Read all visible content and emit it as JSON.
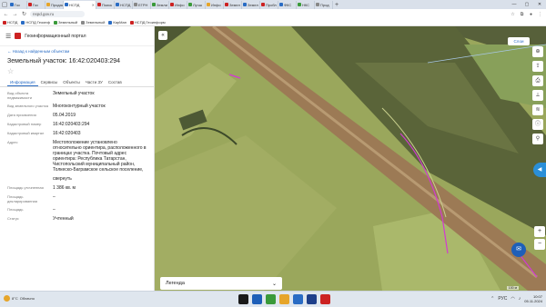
{
  "browser": {
    "tabs": [
      {
        "label": "Гос",
        "color": "#2a6cc4"
      },
      {
        "label": "Гос",
        "color": "#c22"
      },
      {
        "label": "Продаж",
        "color": "#e6a52a"
      },
      {
        "label": "НСПД",
        "color": "#2a6cc4",
        "active": true
      },
      {
        "label": "Поиск",
        "color": "#c22"
      },
      {
        "label": "НСПД",
        "color": "#2a6cc4"
      },
      {
        "label": "ЕГРН",
        "color": "#888"
      },
      {
        "label": "Земли",
        "color": "#3a9a3a"
      },
      {
        "label": "Инфо",
        "color": "#c22"
      },
      {
        "label": "Лучш",
        "color": "#3a9a3a"
      },
      {
        "label": "Инфо",
        "color": "#e6a52a"
      },
      {
        "label": "Земел",
        "color": "#c22"
      },
      {
        "label": "Земел",
        "color": "#2a6cc4"
      },
      {
        "label": "Пробл",
        "color": "#c22"
      },
      {
        "label": "ФКС",
        "color": "#2a6cc4"
      },
      {
        "label": "НКС",
        "color": "#3a9a3a"
      },
      {
        "label": "Прод",
        "color": "#888"
      }
    ],
    "address": "nspd.gov.ru",
    "bookmarks": [
      {
        "label": "НСПД",
        "color": "#c22"
      },
      {
        "label": "НСПД Геоинф",
        "color": "#2a6cc4"
      },
      {
        "label": "Земельный",
        "color": "#3a9a3a"
      },
      {
        "label": "Земельный",
        "color": "#888"
      },
      {
        "label": "КарМап",
        "color": "#2a6cc4"
      },
      {
        "label": "НСПД Геоинформ",
        "color": "#c22"
      }
    ]
  },
  "portal": {
    "name": "Геоинформационный портал",
    "back_link": "Назад к найденным объектам",
    "object_title": "Земельный участок: 16:42:020403:294",
    "tabs": [
      "Информация",
      "Сервисы",
      "Объекты",
      "Части ЗУ",
      "Состав"
    ],
    "selected_tab": "Информация",
    "properties": [
      {
        "key": "Вид объекта недвижимости",
        "value": "Земельный участок"
      },
      {
        "key": "Вид земельного участка",
        "value": "Многоконтурный участок"
      },
      {
        "key": "Дата присвоения",
        "value": "05.04.2019"
      },
      {
        "key": "Кадастровый номер",
        "value": "16:42:020403:294"
      },
      {
        "key": "Кадастровый квартал",
        "value": "16:42:020403"
      },
      {
        "key": "Адрес",
        "value": "Местоположение установлено относительно ориентира, расположенного в границах участка. Почтовый адрес ориентира: Республика Татарстан, Чистопольский муниципальный район, Толкеско-Баграмское сельское поселение,"
      },
      {
        "key": "",
        "value": "свернуть",
        "link": true
      },
      {
        "key": "Площадь уточненная",
        "value": "1 386 кв. м"
      },
      {
        "key": "Площадь декларированная",
        "value": "–"
      },
      {
        "key": "Площадь",
        "value": "–"
      },
      {
        "key": "Статус",
        "value": "Учтенный"
      }
    ]
  },
  "map": {
    "favorites_label": "Слои",
    "legend_label": "Легенда",
    "scale_text": "100 м",
    "tool_icons": [
      "plus-icon",
      "share-icon",
      "print-icon",
      "measure-icon",
      "layers-icon",
      "info-icon",
      "link-icon"
    ],
    "zoom_in": "+",
    "zoom_out": "−"
  },
  "taskbar": {
    "weather": "8°C",
    "weather_text": "Облачно",
    "time": "10:07",
    "date": "05.11.2024",
    "lang": "РУС",
    "app_colors": [
      "#1a1a1a",
      "#1e5fb8",
      "#3a9a3a",
      "#e6a52a",
      "#2a6cc4",
      "#1e3f8a",
      "#c22"
    ]
  }
}
